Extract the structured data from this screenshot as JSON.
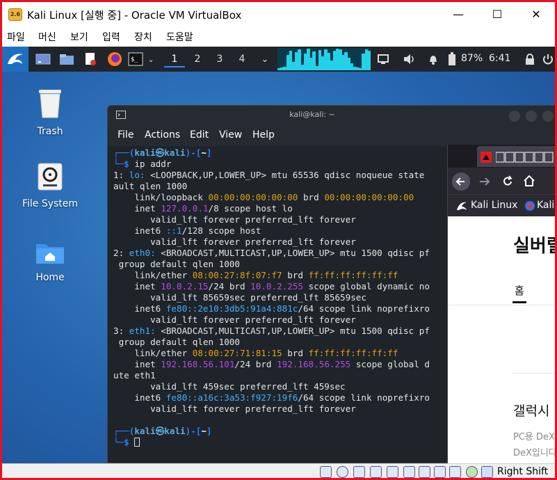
{
  "window": {
    "app_icon_text": "2.6",
    "title": "Kali Linux [실행 중] - Oracle VM VirtualBox",
    "minimize_glyph": "—",
    "maximize_glyph": "☐",
    "close_glyph": "✕"
  },
  "menubar": [
    "파일",
    "머신",
    "보기",
    "입력",
    "장치",
    "도움말"
  ],
  "panel": {
    "workspaces": [
      "1",
      "2",
      "3",
      "4"
    ],
    "active_workspace": 0,
    "battery": "87%",
    "time": "6:41"
  },
  "desktop": {
    "icons": [
      {
        "name": "trash",
        "label": "Trash"
      },
      {
        "name": "file-system",
        "label": "File System"
      },
      {
        "name": "home",
        "label": "Home"
      }
    ]
  },
  "terminal": {
    "title": "kali@kali: ~",
    "menu": [
      "File",
      "Actions",
      "Edit",
      "View",
      "Help"
    ],
    "prompt_user": "kali",
    "prompt_host": "kali",
    "prompt_dir": "~",
    "command": "ip addr"
  },
  "firefox": {
    "bookmarks": [
      "Kali Linux",
      "Kali T"
    ],
    "page": {
      "heading": "실버릴",
      "tab_home": "홈",
      "section_title": "갤럭시 ",
      "line1": "PC용 DeX",
      "line2": "DeX입니다"
    }
  },
  "statusbar": {
    "host_key": "Right Shift"
  },
  "colors": {
    "border_red": "#e81123",
    "panel": "#20252b",
    "terminal_bg": "#1f242a",
    "accent_blue": "#2a8cff",
    "mac_orange": "#e0a20f",
    "ip_purple": "#b44be6"
  }
}
